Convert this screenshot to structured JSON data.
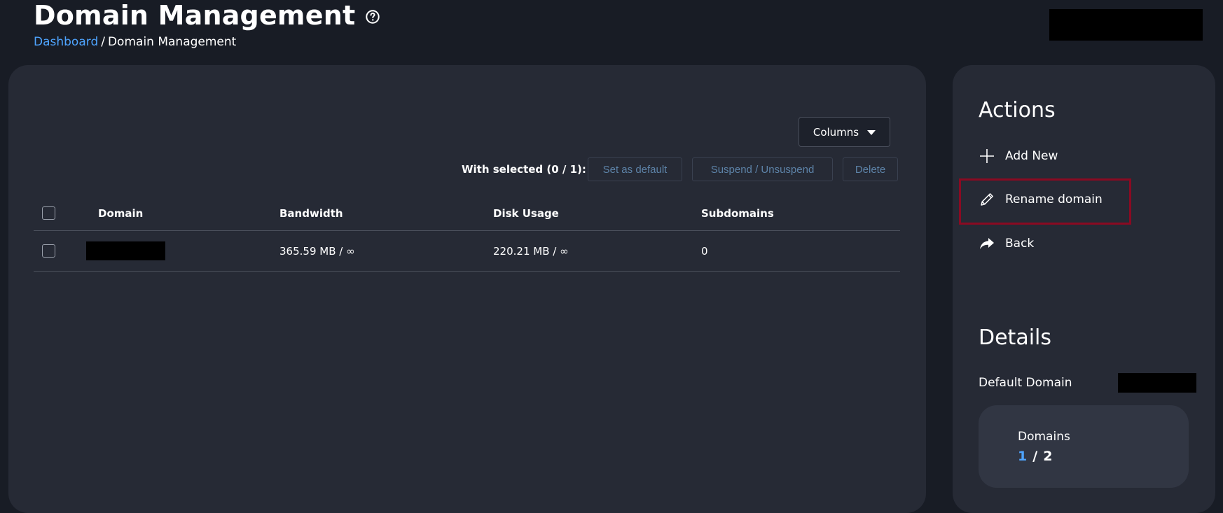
{
  "header": {
    "title": "Domain Management",
    "help_icon": "question-circle-icon",
    "breadcrumb": {
      "link": "Dashboard",
      "separator": "/",
      "current": "Domain Management"
    }
  },
  "toolbar": {
    "columns_label": "Columns",
    "with_selected_label": "With selected (0 / 1):",
    "set_default_label": "Set as default",
    "suspend_label": "Suspend / Unsuspend",
    "delete_label": "Delete"
  },
  "table": {
    "columns": [
      "Domain",
      "Bandwidth",
      "Disk Usage",
      "Subdomains"
    ],
    "rows": [
      {
        "domain": "",
        "bandwidth": "365.59 MB / ∞",
        "disk_usage": "220.21 MB / ∞",
        "subdomains": "0"
      }
    ]
  },
  "actions": {
    "heading": "Actions",
    "items": [
      {
        "label": "Add New",
        "icon": "plus-icon"
      },
      {
        "label": "Rename domain",
        "icon": "pencil-icon"
      },
      {
        "label": "Back",
        "icon": "share-arrow-icon"
      }
    ]
  },
  "details": {
    "heading": "Details",
    "default_domain_label": "Default Domain",
    "domains_card": {
      "title": "Domains",
      "used": "1",
      "separator": "/",
      "total": "2"
    }
  },
  "colors": {
    "background": "#181c25",
    "panel": "#262a35",
    "accent": "#4ea4ff",
    "highlight": "#8a0a22"
  }
}
